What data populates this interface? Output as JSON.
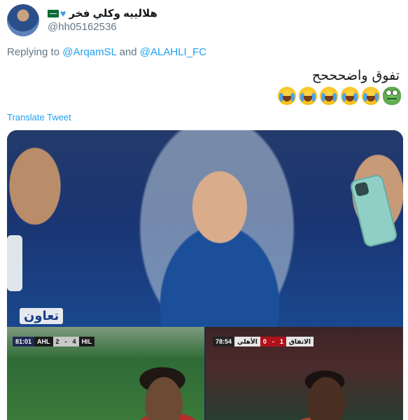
{
  "tweet": {
    "display_name": "هلالييه وكلي فخر",
    "handle": "@hh05162536",
    "replying_prefix": "Replying to",
    "replying_to": [
      "@ArqamSL",
      "@ALAHLI_FC"
    ],
    "replying_joiner": "and",
    "text": "تفوق واضحححح",
    "emojis": [
      "loudly-crying-face",
      "loudly-crying-face",
      "loudly-crying-face",
      "loudly-crying-face",
      "loudly-crying-face",
      "frog-face"
    ],
    "translate_label": "Translate Tweet"
  },
  "media": {
    "main_photo_sign_text": "تعاون",
    "left_clip": {
      "time": "81:01",
      "home": "AHL",
      "home_score": "2",
      "separator": "-",
      "away_score": "4",
      "away": "HIL"
    },
    "right_clip": {
      "time": "78:54",
      "home": "الأهلي",
      "home_score": "0",
      "separator": "-",
      "away_score": "1",
      "away": "الاتفاق"
    }
  },
  "colors": {
    "link": "#1da1f2",
    "muted": "#657786",
    "text": "#14171a"
  }
}
